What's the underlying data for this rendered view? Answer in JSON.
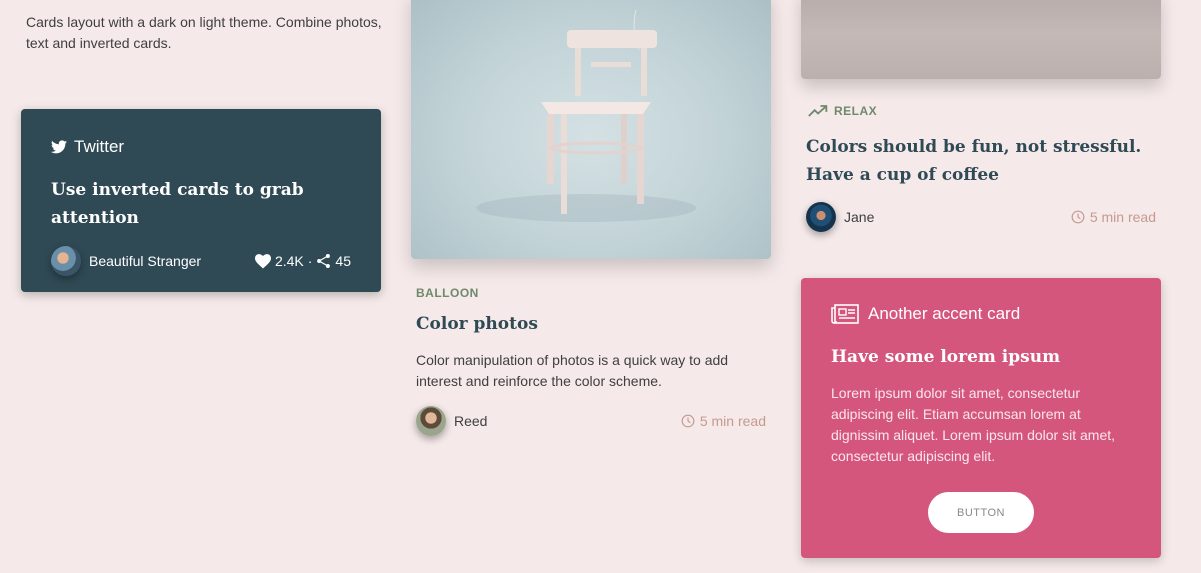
{
  "intro": {
    "text": "Cards layout with a dark on light theme. Combine photos, text and inverted cards."
  },
  "twitter_card": {
    "network": "Twitter",
    "title": "Use inverted cards to grab attention",
    "author": "Beautiful Stranger",
    "likes": "2.4K",
    "separator": "·",
    "shares": "45",
    "background": "#2f4a55"
  },
  "photo_card": {
    "kicker": "BALLOON",
    "title": "Color photos",
    "body": "Color manipulation of photos is a quick way to add interest and reinforce the color scheme.",
    "author": "Reed",
    "read_time": "5 min read"
  },
  "relax_card": {
    "kicker": "RELAX",
    "title": "Colors should be fun, not stressful. Have a cup of coffee",
    "author": "Jane",
    "read_time": "5 min read"
  },
  "accent_card": {
    "header": "Another accent card",
    "title": "Have some lorem ipsum",
    "body": "Lorem ipsum dolor sit amet, consectetur adipiscing elit. Etiam accumsan lorem at dignissim aliquet. Lorem ipsum dolor sit amet, consectetur adipiscing elit.",
    "button_label": "BUTTON",
    "background": "#d4567c"
  },
  "icons": {
    "twitter": "twitter-icon",
    "heart": "heart-icon",
    "share": "share-icon",
    "clock": "clock-icon",
    "trending": "trending-up-icon",
    "newspaper": "newspaper-icon"
  },
  "colors": {
    "page_background": "#f5e9e9",
    "kicker": "#6e8a6a",
    "heading": "#2f4a55",
    "read_time": "#c69a8f"
  }
}
